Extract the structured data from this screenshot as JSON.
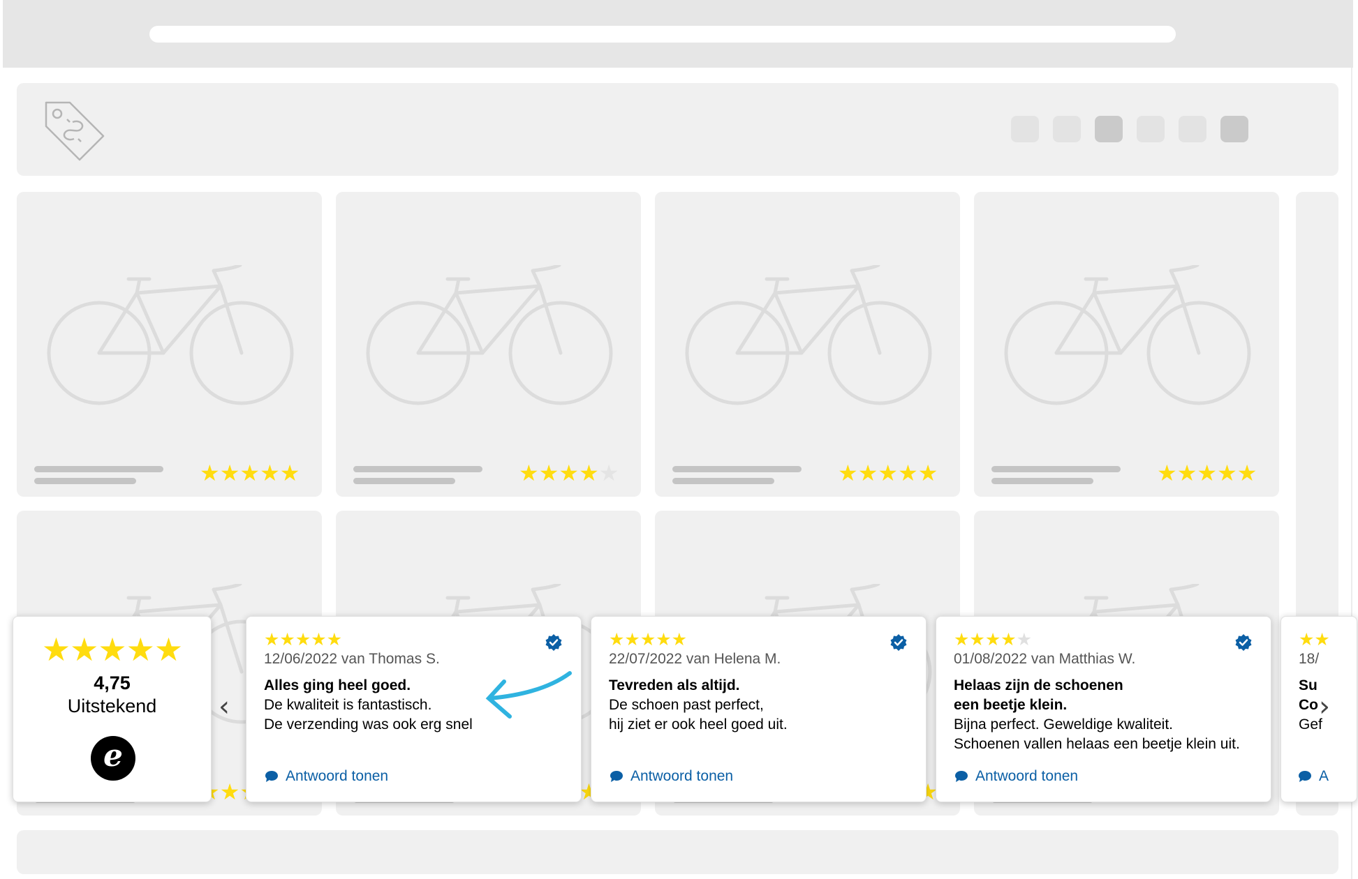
{
  "products": [
    {
      "rating": 5
    },
    {
      "rating": 4
    },
    {
      "rating": 5
    },
    {
      "rating": 5
    }
  ],
  "widget": {
    "summary": {
      "stars": "★★★★★",
      "score": "4,75",
      "grade": "Uitstekend",
      "logo_letter": "e"
    },
    "prev_arrow": "‹",
    "next_arrow": "›",
    "reviews": [
      {
        "rating": 5,
        "meta": "12/06/2022 van Thomas S.",
        "title": "Alles ging heel goed.",
        "body": [
          "De kwaliteit is fantastisch.",
          "De verzending was ook erg snel"
        ],
        "reply": "Antwoord tonen"
      },
      {
        "rating": 5,
        "meta": "22/07/2022 van Helena M.",
        "title": "Tevreden als altijd.",
        "body": [
          "De schoen past perfect,",
          "hij ziet er ook heel goed uit."
        ],
        "reply": "Antwoord tonen"
      },
      {
        "rating": 4,
        "meta": "01/08/2022 van Matthias W.",
        "title_lines": [
          "Helaas zijn de schoenen",
          "een beetje klein."
        ],
        "body": [
          "Bijna perfect. Geweldige kwaliteit.",
          "Schoenen vallen helaas een beetje klein uit."
        ],
        "reply": "Antwoord tonen"
      }
    ],
    "partial_review": {
      "meta": "18/",
      "title_1": "Su",
      "title_2": "Co",
      "body": "Gef",
      "reply": "A"
    }
  },
  "colors": {
    "star": "#ffdc0f",
    "link": "#0b5fa5",
    "verified": "#0b5fa5",
    "annotation_arrow": "#2fb3e0"
  }
}
